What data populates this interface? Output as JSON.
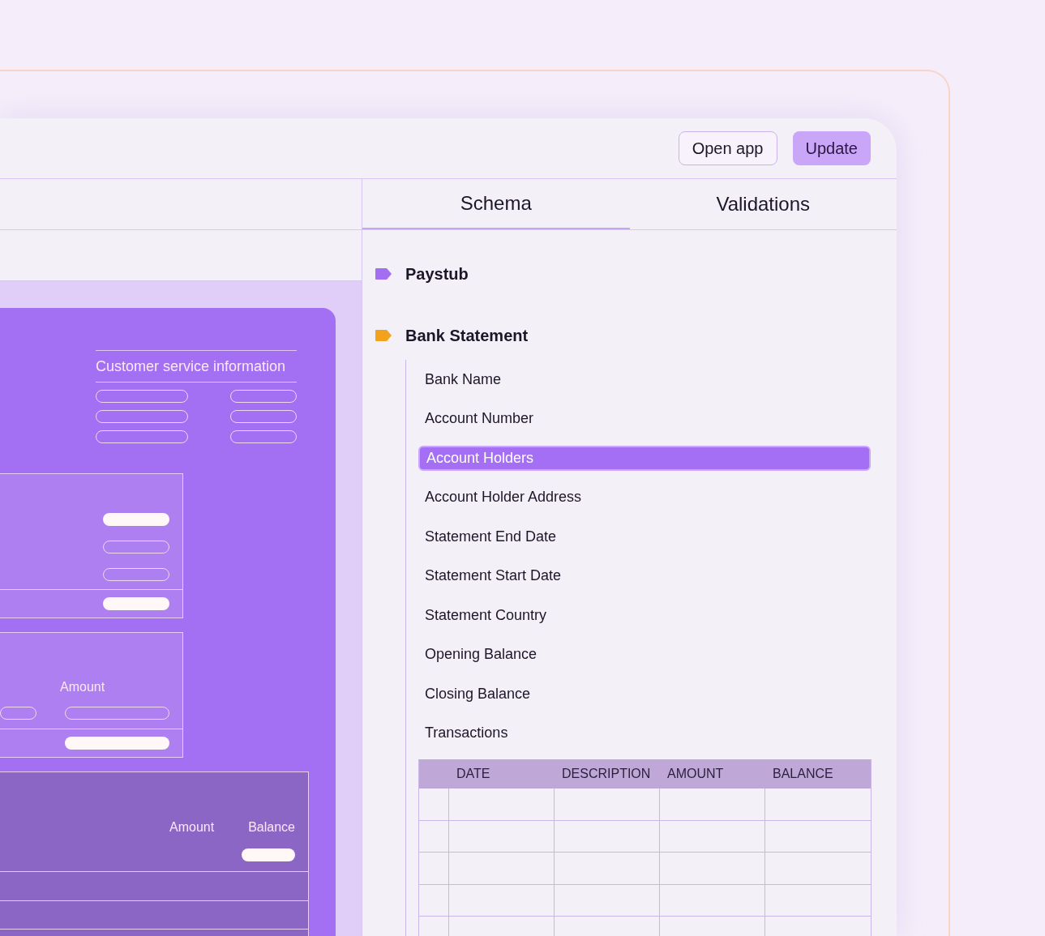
{
  "header": {
    "buttons": [
      {
        "label": "Open app",
        "kind": "outline"
      },
      {
        "label": "Update",
        "kind": "primary"
      }
    ]
  },
  "document": {
    "section_title": "Customer service information",
    "amount_label": "Amount",
    "table_headers": [
      "Amount",
      "Balance"
    ]
  },
  "tabs": [
    {
      "label": "Schema",
      "selected": true
    },
    {
      "label": "Validations",
      "selected": false
    }
  ],
  "schema": [
    {
      "name": "Paystub",
      "color": "#a46ef0"
    },
    {
      "name": "Bank Statement",
      "color": "#f2a31b",
      "children": [
        {
          "name": "Bank Name",
          "selected": false
        },
        {
          "name": "Account Number",
          "selected": false
        },
        {
          "name": "Account Holders",
          "selected": true
        },
        {
          "name": "Account Holder Address",
          "selected": false
        },
        {
          "name": "Statement End Date",
          "selected": false
        },
        {
          "name": "Statement Start Date",
          "selected": false
        },
        {
          "name": "Statement Country",
          "selected": false
        },
        {
          "name": "Opening Balance",
          "selected": false
        },
        {
          "name": "Closing Balance",
          "selected": false
        },
        {
          "name": "Transactions",
          "selected": false,
          "columns": [
            "DATE",
            "DESCRIPTION",
            "AMOUNT",
            "BALANCE"
          ]
        }
      ]
    }
  ]
}
